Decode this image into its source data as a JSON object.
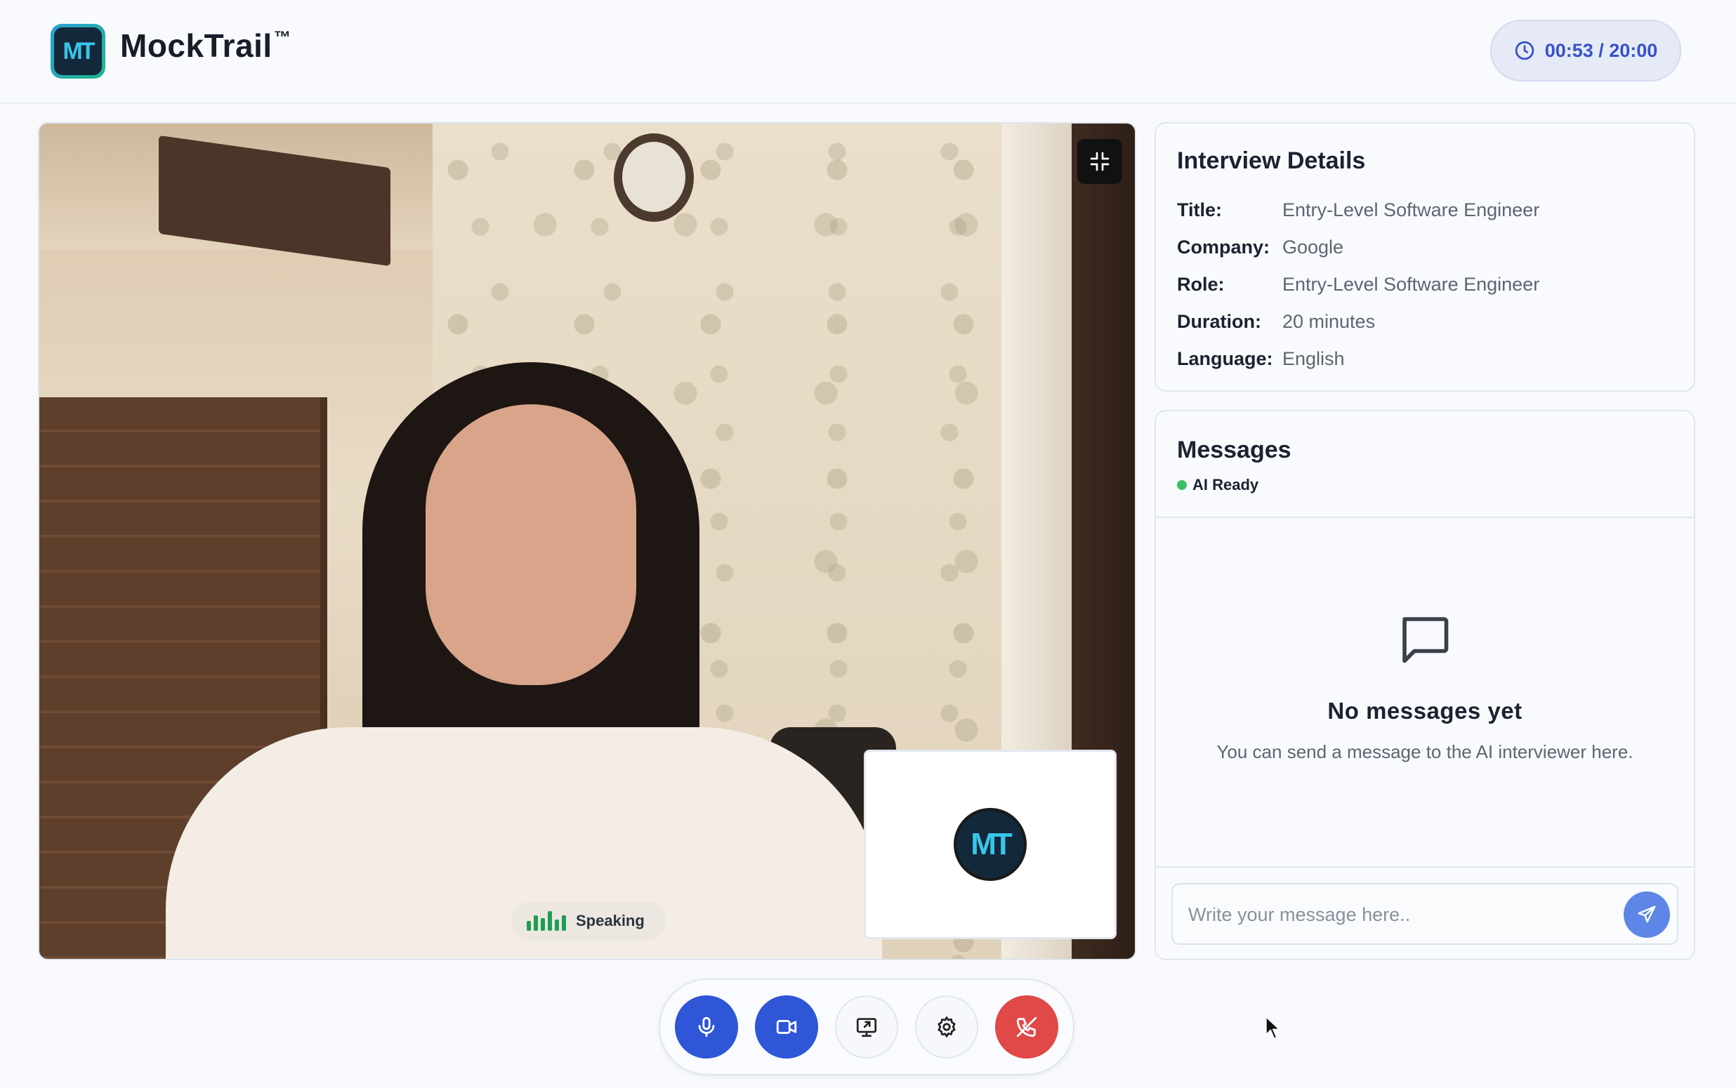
{
  "app": {
    "brand": "MockTrail",
    "trademark": "™",
    "logo_text": "MT"
  },
  "timer": {
    "text": "00:53 / 20:00",
    "icon": "clock-icon"
  },
  "video": {
    "speaking_label": "Speaking",
    "ai_avatar_text": "MT",
    "minimize_icon": "minimize-icon"
  },
  "controls": [
    {
      "name": "microphone",
      "icon": "microphone-icon",
      "state": "on"
    },
    {
      "name": "camera",
      "icon": "camera-icon",
      "state": "on"
    },
    {
      "name": "screen-share",
      "icon": "screen-share-icon",
      "state": "off"
    },
    {
      "name": "settings",
      "icon": "gear-icon",
      "state": "off"
    },
    {
      "name": "end-call",
      "icon": "phone-hangup-icon",
      "state": "danger"
    }
  ],
  "details": {
    "title": "Interview Details",
    "rows": [
      {
        "label": "Title:",
        "value": "Entry-Level Software Engineer"
      },
      {
        "label": "Company:",
        "value": "Google"
      },
      {
        "label": "Role:",
        "value": "Entry-Level Software Engineer"
      },
      {
        "label": "Duration:",
        "value": "20 minutes"
      },
      {
        "label": "Language:",
        "value": "English"
      }
    ]
  },
  "messages": {
    "title": "Messages",
    "status": "AI Ready",
    "empty_title": "No messages yet",
    "empty_subtitle": "You can send a message to the AI interviewer here.",
    "input_placeholder": "Write your message here..",
    "input_value": ""
  },
  "colors": {
    "primary": "#2f56d6",
    "danger": "#e14848",
    "status_ok": "#3fbf64",
    "timer_text": "#3552c9"
  }
}
